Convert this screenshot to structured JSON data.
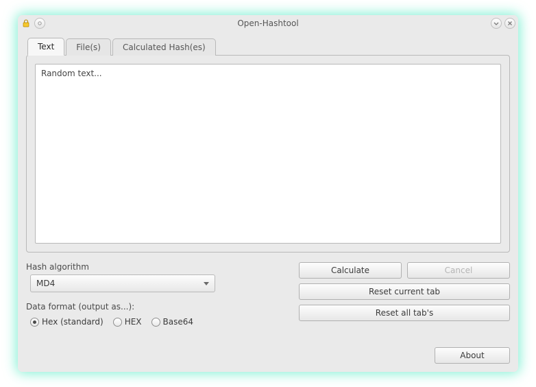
{
  "window": {
    "title": "Open-Hashtool"
  },
  "tabs": [
    {
      "label": "Text",
      "active": true
    },
    {
      "label": "File(s)",
      "active": false
    },
    {
      "label": "Calculated Hash(es)",
      "active": false
    }
  ],
  "text_area": {
    "value": "Random text..."
  },
  "hash_algorithm": {
    "label": "Hash algorithm",
    "selected": "MD4"
  },
  "data_format": {
    "label": "Data format (output as...):",
    "options": [
      {
        "label": "Hex (standard)",
        "checked": true
      },
      {
        "label": "HEX",
        "checked": false
      },
      {
        "label": "Base64",
        "checked": false
      }
    ]
  },
  "buttons": {
    "calculate": "Calculate",
    "cancel": "Cancel",
    "reset_current": "Reset current tab",
    "reset_all": "Reset all tab's",
    "about": "About"
  }
}
